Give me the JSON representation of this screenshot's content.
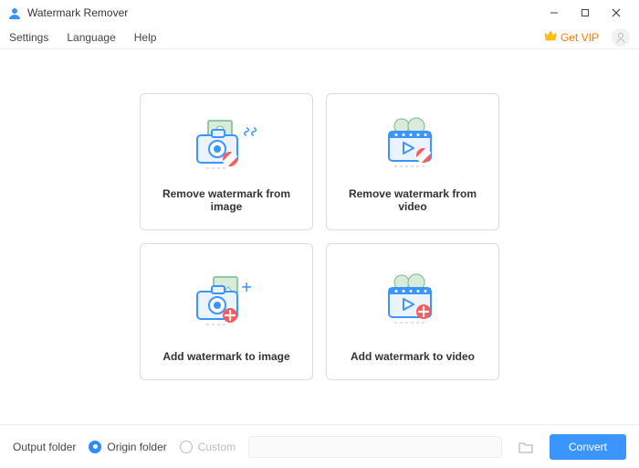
{
  "titlebar": {
    "title": "Watermark Remover"
  },
  "menu": {
    "settings": "Settings",
    "language": "Language",
    "help": "Help",
    "vip": "Get VIP"
  },
  "cards": {
    "remove_image": "Remove watermark from image",
    "remove_video": "Remove watermark from video",
    "add_image": "Add watermark to image",
    "add_video": "Add watermark to video"
  },
  "bottom": {
    "output_label": "Output folder",
    "origin": "Origin folder",
    "custom": "Custom",
    "convert": "Convert",
    "selected": "origin"
  },
  "colors": {
    "accent": "#3b95ff",
    "vip": "#ff7a00"
  }
}
